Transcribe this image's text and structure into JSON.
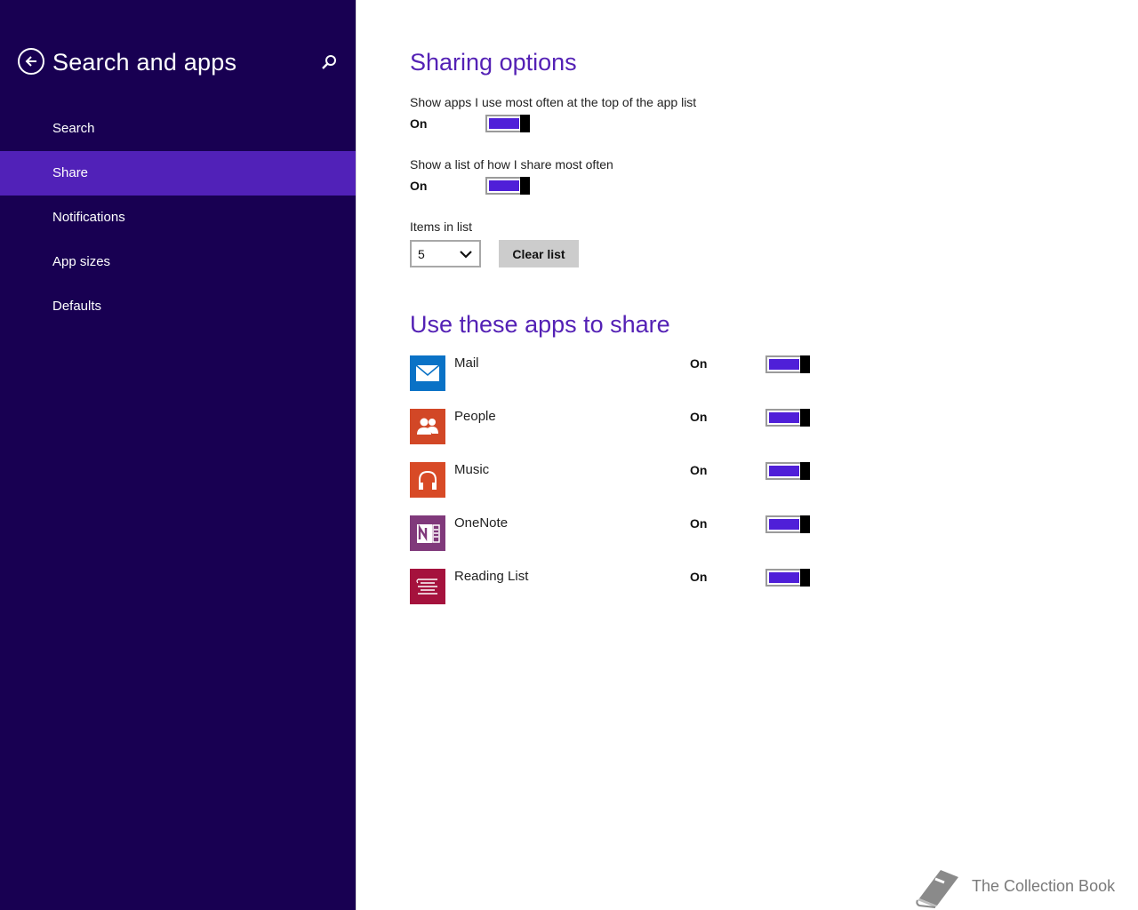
{
  "sidebar": {
    "title": "Search and apps",
    "items": [
      {
        "label": "Search"
      },
      {
        "label": "Share"
      },
      {
        "label": "Notifications"
      },
      {
        "label": "App sizes"
      },
      {
        "label": "Defaults"
      }
    ],
    "active_item": "Share"
  },
  "sharing": {
    "title": "Sharing options",
    "option1": {
      "label": "Show apps I use most often at the top of the app list",
      "state": "On"
    },
    "option2": {
      "label": "Show a list of how I share most often",
      "state": "On"
    },
    "items_label": "Items in list",
    "items_value": "5",
    "clear_label": "Clear list"
  },
  "apps": {
    "title": "Use these apps to share",
    "list": [
      {
        "name": "Mail",
        "state": "On",
        "color": "#0a72c6",
        "icon": "mail-icon"
      },
      {
        "name": "People",
        "state": "On",
        "color": "#d24726",
        "icon": "people-icon"
      },
      {
        "name": "Music",
        "state": "On",
        "color": "#d84a26",
        "icon": "headphones-icon"
      },
      {
        "name": "OneNote",
        "state": "On",
        "color": "#80397b",
        "icon": "onenote-icon"
      },
      {
        "name": "Reading List",
        "state": "On",
        "color": "#a5123d",
        "icon": "reading-list-icon"
      }
    ]
  },
  "watermark": {
    "text": "The Collection Book"
  },
  "colors": {
    "sidebar_bg": "#180052",
    "sidebar_active": "#5121b8",
    "accent": "#5421b5",
    "toggle_fill": "#4f1fd8"
  }
}
